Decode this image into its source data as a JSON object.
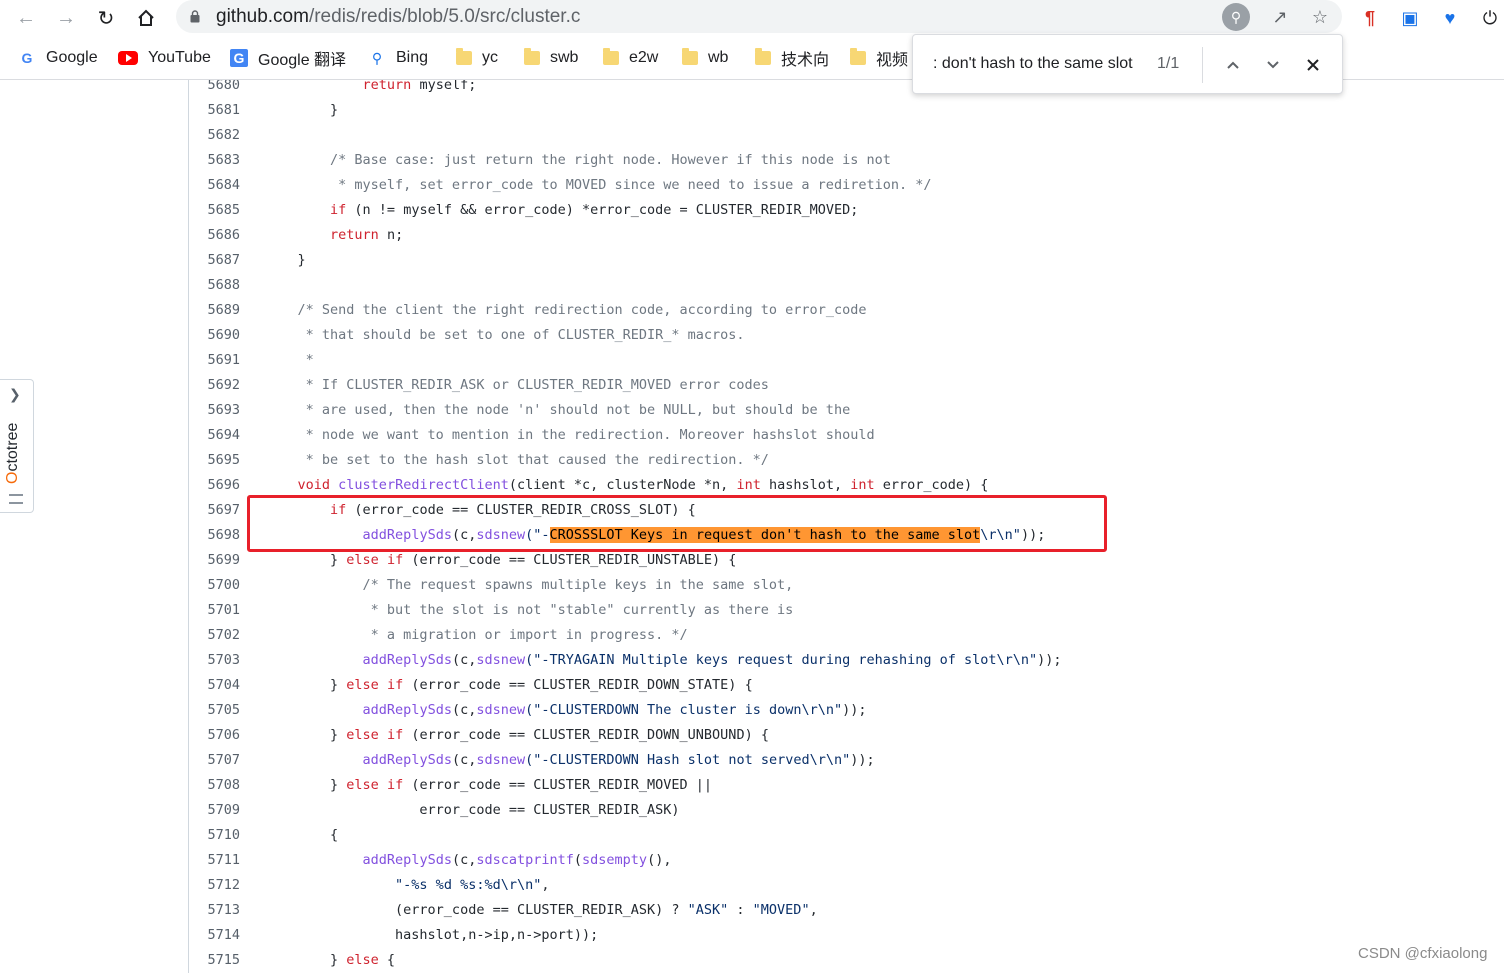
{
  "browser": {
    "url_domain": "github.com",
    "url_path": "/redis/redis/blob/5.0/src/cluster.c"
  },
  "bookmarks": [
    {
      "label": "Google",
      "icon": "google-icon"
    },
    {
      "label": "YouTube",
      "icon": "youtube-icon"
    },
    {
      "label": "Google 翻译",
      "icon": "google-translate-icon"
    },
    {
      "label": "Bing",
      "icon": "search-icon"
    },
    {
      "label": "yc",
      "icon": "folder-icon"
    },
    {
      "label": "swb",
      "icon": "folder-icon"
    },
    {
      "label": "e2w",
      "icon": "folder-icon"
    },
    {
      "label": "wb",
      "icon": "folder-icon"
    },
    {
      "label": "技术向",
      "icon": "folder-icon"
    },
    {
      "label": "视频",
      "icon": "folder-icon"
    }
  ],
  "find_bar": {
    "query": ": don't hash to the same slot",
    "count": "1/1"
  },
  "octotree": {
    "label_o": "O",
    "label_rest": "ctotree"
  },
  "code": {
    "lines": [
      {
        "num": "5680",
        "segs": [
          {
            "t": "            "
          },
          {
            "t": "return",
            "c": "kw"
          },
          {
            "t": " myself;"
          }
        ]
      },
      {
        "num": "5681",
        "segs": [
          {
            "t": "        }"
          }
        ]
      },
      {
        "num": "5682",
        "segs": [
          {
            "t": ""
          }
        ]
      },
      {
        "num": "5683",
        "segs": [
          {
            "t": "        "
          },
          {
            "t": "/* Base case: just return the right node. However if this node is not",
            "c": "cm"
          }
        ]
      },
      {
        "num": "5684",
        "segs": [
          {
            "t": "         * myself, set error_code to MOVED since we need to issue a rediretion. */",
            "c": "cm"
          }
        ]
      },
      {
        "num": "5685",
        "segs": [
          {
            "t": "        "
          },
          {
            "t": "if",
            "c": "kw"
          },
          {
            "t": " (n != myself && error_code) *error_code = CLUSTER_REDIR_MOVED;"
          }
        ]
      },
      {
        "num": "5686",
        "segs": [
          {
            "t": "        "
          },
          {
            "t": "return",
            "c": "kw"
          },
          {
            "t": " n;"
          }
        ]
      },
      {
        "num": "5687",
        "segs": [
          {
            "t": "    }"
          }
        ]
      },
      {
        "num": "5688",
        "segs": [
          {
            "t": ""
          }
        ]
      },
      {
        "num": "5689",
        "segs": [
          {
            "t": "    "
          },
          {
            "t": "/* Send the client the right redirection code, according to error_code",
            "c": "cm"
          }
        ]
      },
      {
        "num": "5690",
        "segs": [
          {
            "t": "     * that should be set to one of CLUSTER_REDIR_* macros.",
            "c": "cm"
          }
        ]
      },
      {
        "num": "5691",
        "segs": [
          {
            "t": "     *",
            "c": "cm"
          }
        ]
      },
      {
        "num": "5692",
        "segs": [
          {
            "t": "     * If CLUSTER_REDIR_ASK or CLUSTER_REDIR_MOVED error codes",
            "c": "cm"
          }
        ]
      },
      {
        "num": "5693",
        "segs": [
          {
            "t": "     * are used, then the node 'n' should not be NULL, but should be the",
            "c": "cm"
          }
        ]
      },
      {
        "num": "5694",
        "segs": [
          {
            "t": "     * node we want to mention in the redirection. Moreover hashslot should",
            "c": "cm"
          }
        ]
      },
      {
        "num": "5695",
        "segs": [
          {
            "t": "     * be set to the hash slot that caused the redirection. */",
            "c": "cm"
          }
        ]
      },
      {
        "num": "5696",
        "segs": [
          {
            "t": "    "
          },
          {
            "t": "void",
            "c": "kw"
          },
          {
            "t": " "
          },
          {
            "t": "clusterRedirectClient",
            "c": "fn"
          },
          {
            "t": "(client *c, clusterNode *n, "
          },
          {
            "t": "int",
            "c": "kw"
          },
          {
            "t": " hashslot, "
          },
          {
            "t": "int",
            "c": "kw"
          },
          {
            "t": " error_code) {"
          }
        ]
      },
      {
        "num": "5697",
        "segs": [
          {
            "t": "        "
          },
          {
            "t": "if",
            "c": "kw"
          },
          {
            "t": " (error_code == CLUSTER_REDIR_CROSS_SLOT) {"
          }
        ]
      },
      {
        "num": "5698",
        "segs": [
          {
            "t": "            "
          },
          {
            "t": "addReplySds",
            "c": "fn"
          },
          {
            "t": "(c,"
          },
          {
            "t": "sdsnew",
            "c": "fn"
          },
          {
            "t": "(\"-",
            "c": "st"
          },
          {
            "t": "CROSSSLOT Keys in request don't hash to the same slot",
            "c": "hl"
          },
          {
            "t": "\\r\\n\"",
            "c": "st"
          },
          {
            "t": "));"
          }
        ]
      },
      {
        "num": "5699",
        "segs": [
          {
            "t": "        } "
          },
          {
            "t": "else",
            "c": "kw"
          },
          {
            "t": " "
          },
          {
            "t": "if",
            "c": "kw"
          },
          {
            "t": " (error_code == CLUSTER_REDIR_UNSTABLE) {"
          }
        ]
      },
      {
        "num": "5700",
        "segs": [
          {
            "t": "            "
          },
          {
            "t": "/* The request spawns multiple keys in the same slot,",
            "c": "cm"
          }
        ]
      },
      {
        "num": "5701",
        "segs": [
          {
            "t": "             * but the slot is not \"stable\" currently as there is",
            "c": "cm"
          }
        ]
      },
      {
        "num": "5702",
        "segs": [
          {
            "t": "             * a migration or import in progress. */",
            "c": "cm"
          }
        ]
      },
      {
        "num": "5703",
        "segs": [
          {
            "t": "            "
          },
          {
            "t": "addReplySds",
            "c": "fn"
          },
          {
            "t": "(c,"
          },
          {
            "t": "sdsnew",
            "c": "fn"
          },
          {
            "t": "(\"-TRYAGAIN Multiple keys request during rehashing of slot\\r\\n\"",
            "c": "st"
          },
          {
            "t": "));"
          }
        ]
      },
      {
        "num": "5704",
        "segs": [
          {
            "t": "        } "
          },
          {
            "t": "else",
            "c": "kw"
          },
          {
            "t": " "
          },
          {
            "t": "if",
            "c": "kw"
          },
          {
            "t": " (error_code == CLUSTER_REDIR_DOWN_STATE) {"
          }
        ]
      },
      {
        "num": "5705",
        "segs": [
          {
            "t": "            "
          },
          {
            "t": "addReplySds",
            "c": "fn"
          },
          {
            "t": "(c,"
          },
          {
            "t": "sdsnew",
            "c": "fn"
          },
          {
            "t": "(\"-CLUSTERDOWN The cluster is down\\r\\n\"",
            "c": "st"
          },
          {
            "t": "));"
          }
        ]
      },
      {
        "num": "5706",
        "segs": [
          {
            "t": "        } "
          },
          {
            "t": "else",
            "c": "kw"
          },
          {
            "t": " "
          },
          {
            "t": "if",
            "c": "kw"
          },
          {
            "t": " (error_code == CLUSTER_REDIR_DOWN_UNBOUND) {"
          }
        ]
      },
      {
        "num": "5707",
        "segs": [
          {
            "t": "            "
          },
          {
            "t": "addReplySds",
            "c": "fn"
          },
          {
            "t": "(c,"
          },
          {
            "t": "sdsnew",
            "c": "fn"
          },
          {
            "t": "(\"-CLUSTERDOWN Hash slot not served\\r\\n\"",
            "c": "st"
          },
          {
            "t": "));"
          }
        ]
      },
      {
        "num": "5708",
        "segs": [
          {
            "t": "        } "
          },
          {
            "t": "else",
            "c": "kw"
          },
          {
            "t": " "
          },
          {
            "t": "if",
            "c": "kw"
          },
          {
            "t": " (error_code == CLUSTER_REDIR_MOVED ||"
          }
        ]
      },
      {
        "num": "5709",
        "segs": [
          {
            "t": "                   error_code == CLUSTER_REDIR_ASK)"
          }
        ]
      },
      {
        "num": "5710",
        "segs": [
          {
            "t": "        {"
          }
        ]
      },
      {
        "num": "5711",
        "segs": [
          {
            "t": "            "
          },
          {
            "t": "addReplySds",
            "c": "fn"
          },
          {
            "t": "(c,"
          },
          {
            "t": "sdscatprintf",
            "c": "fn"
          },
          {
            "t": "("
          },
          {
            "t": "sdsempty",
            "c": "fn"
          },
          {
            "t": "(),"
          }
        ]
      },
      {
        "num": "5712",
        "segs": [
          {
            "t": "                "
          },
          {
            "t": "\"-%s %d %s:%d\\r\\n\"",
            "c": "st"
          },
          {
            "t": ","
          }
        ]
      },
      {
        "num": "5713",
        "segs": [
          {
            "t": "                (error_code == CLUSTER_REDIR_ASK) ? "
          },
          {
            "t": "\"ASK\"",
            "c": "st"
          },
          {
            "t": " : "
          },
          {
            "t": "\"MOVED\"",
            "c": "st"
          },
          {
            "t": ","
          }
        ]
      },
      {
        "num": "5714",
        "segs": [
          {
            "t": "                hashslot,n->ip,n->port));"
          }
        ]
      },
      {
        "num": "5715",
        "segs": [
          {
            "t": "        } "
          },
          {
            "t": "else",
            "c": "kw"
          },
          {
            "t": " {"
          }
        ]
      }
    ]
  },
  "watermark": "CSDN @cfxiaolong",
  "colors": {
    "highlight": "#ff9632",
    "annotation_box": "#e8202a"
  }
}
